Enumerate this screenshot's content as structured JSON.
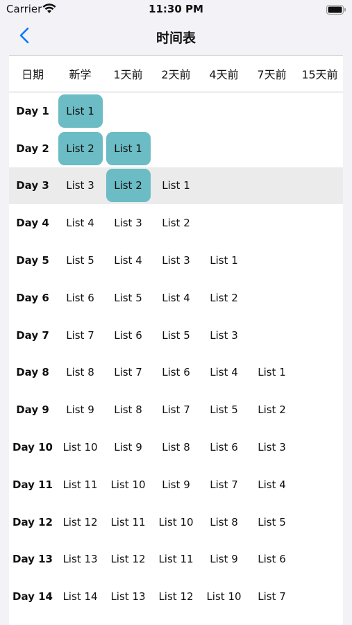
{
  "status_bar": {
    "carrier": "Carrier",
    "time": "11:30 PM"
  },
  "nav": {
    "title": "时间表"
  },
  "headers": [
    "日期",
    "新学",
    "1天前",
    "2天前",
    "4天前",
    "7天前",
    "15天前"
  ],
  "rows": [
    {
      "day": "Day 1",
      "cells": [
        "List 1",
        "",
        "",
        "",
        "",
        ""
      ]
    },
    {
      "day": "Day 2",
      "cells": [
        "List 2",
        "List 1",
        "",
        "",
        "",
        ""
      ]
    },
    {
      "day": "Day 3",
      "cells": [
        "List 3",
        "List 2",
        "List 1",
        "",
        "",
        ""
      ]
    },
    {
      "day": "Day 4",
      "cells": [
        "List 4",
        "List 3",
        "List 2",
        "",
        "",
        ""
      ]
    },
    {
      "day": "Day 5",
      "cells": [
        "List 5",
        "List 4",
        "List 3",
        "List 1",
        "",
        ""
      ]
    },
    {
      "day": "Day 6",
      "cells": [
        "List 6",
        "List 5",
        "List 4",
        "List 2",
        "",
        ""
      ]
    },
    {
      "day": "Day 7",
      "cells": [
        "List 7",
        "List 6",
        "List 5",
        "List 3",
        "",
        ""
      ]
    },
    {
      "day": "Day 8",
      "cells": [
        "List 8",
        "List 7",
        "List 6",
        "List 4",
        "List 1",
        ""
      ]
    },
    {
      "day": "Day 9",
      "cells": [
        "List 9",
        "List 8",
        "List 7",
        "List 5",
        "List 2",
        ""
      ]
    },
    {
      "day": "Day 10",
      "cells": [
        "List 10",
        "List 9",
        "List 8",
        "List 6",
        "List 3",
        ""
      ]
    },
    {
      "day": "Day 11",
      "cells": [
        "List 11",
        "List 10",
        "List 9",
        "List 7",
        "List 4",
        ""
      ]
    },
    {
      "day": "Day 12",
      "cells": [
        "List 12",
        "List 11",
        "List 10",
        "List 8",
        "List 5",
        ""
      ]
    },
    {
      "day": "Day 13",
      "cells": [
        "List 13",
        "List 12",
        "List 11",
        "List 9",
        "List 6",
        ""
      ]
    },
    {
      "day": "Day 14",
      "cells": [
        "List 14",
        "List 13",
        "List 12",
        "List 10",
        "List 7",
        ""
      ]
    }
  ],
  "completed_cells": [
    [
      0,
      0
    ],
    [
      1,
      0
    ],
    [
      1,
      1
    ],
    [
      2,
      1
    ]
  ],
  "highlighted_row": 2,
  "colors": {
    "accent": "#007aff",
    "completed": "#6bbcc4",
    "row_highlight": "#ebebeb"
  },
  "icons": {
    "back": "chevron-left-icon",
    "wifi": "wifi-icon",
    "battery": "battery-icon"
  }
}
